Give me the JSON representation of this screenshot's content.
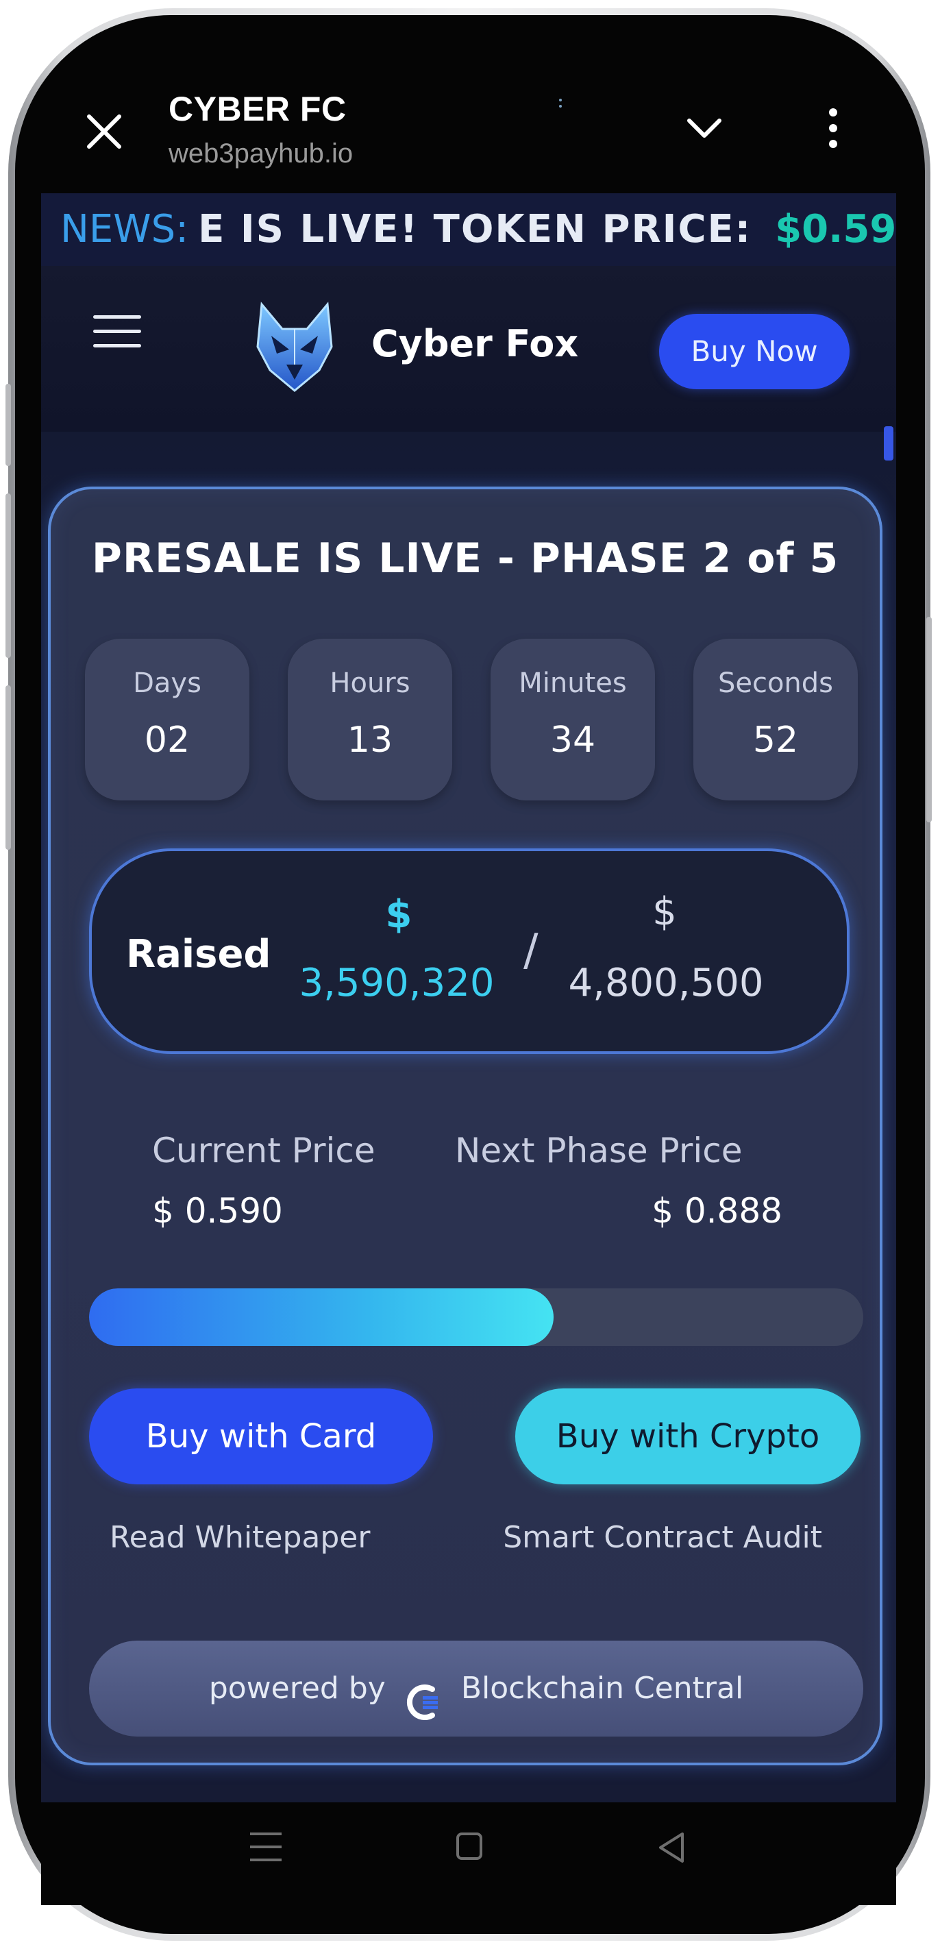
{
  "browser": {
    "title": "CYBER FC",
    "url": "web3payhub.io"
  },
  "ticker": {
    "label": "NEWS:",
    "text": "E IS LIVE! TOKEN PRICE:",
    "price": "$0.59"
  },
  "header": {
    "brand": "Cyber Fox",
    "buy_now_label": "Buy Now"
  },
  "presale": {
    "title": "PRESALE IS LIVE - PHASE 2 of 5",
    "countdown": [
      {
        "label": "Days",
        "value": "02"
      },
      {
        "label": "Hours",
        "value": "13"
      },
      {
        "label": "Minutes",
        "value": "34"
      },
      {
        "label": "Seconds",
        "value": "52"
      }
    ],
    "raised": {
      "label": "Raised",
      "current_symbol": "$",
      "current_value": "3,590,320",
      "separator": "/",
      "goal_symbol": "$",
      "goal_value": "4,800,500"
    },
    "current_price_label": "Current Price",
    "current_price": "$ 0.590",
    "next_price_label": "Next Phase Price",
    "next_price": "$ 0.888",
    "progress_fraction": 0.6,
    "buy_card_label": "Buy with Card",
    "buy_crypto_label": "Buy with Crypto",
    "whitepaper_label": "Read Whitepaper",
    "audit_label": "Smart Contract Audit",
    "powered_by_prefix": "powered by",
    "powered_by_name": "Blockchain Central"
  },
  "colors": {
    "accent_blue": "#2a4cf0",
    "accent_cyan": "#3ccfe8",
    "ticker_price": "#1ac7b0",
    "card_border": "#5b8ad8"
  },
  "icons": {
    "close": "close-icon",
    "chevron": "chevron-down-icon",
    "menu": "more-vertical-icon",
    "hamburger": "hamburger-menu-icon",
    "logo": "fox-logo-icon",
    "powered_logo": "blockchain-central-logo-icon"
  }
}
